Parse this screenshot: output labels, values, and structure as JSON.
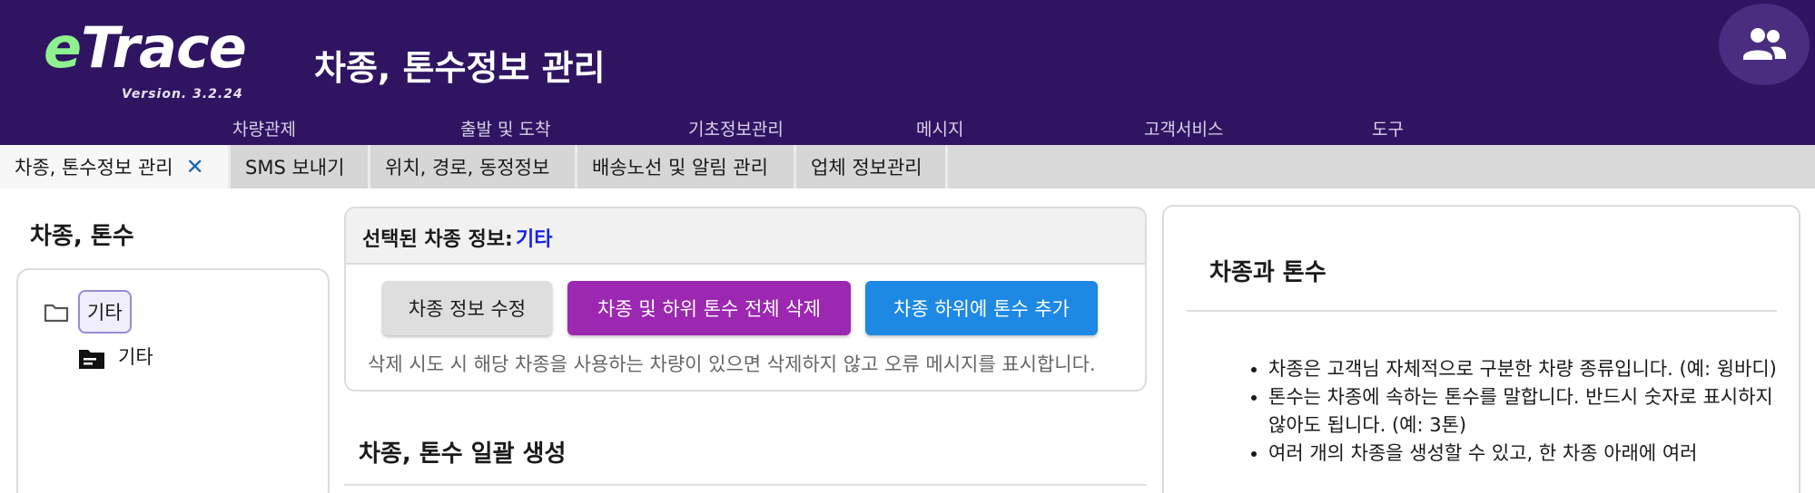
{
  "app": {
    "logo_e": "e",
    "logo_rest": "Trace",
    "version": "Version. 3.2.24",
    "page_title": "차종, 톤수정보 관리"
  },
  "menu": {
    "items": [
      "차량관제",
      "출발 및 도착",
      "기초정보관리",
      "메시지",
      "고객서비스",
      "도구"
    ]
  },
  "header_icon": "users-icon",
  "tabs": [
    {
      "label": "차종, 톤수정보 관리",
      "active": true,
      "closable": true
    },
    {
      "label": "SMS 보내기",
      "active": false
    },
    {
      "label": "위치, 경로, 동정정보",
      "active": false
    },
    {
      "label": "배송노선 및 알림 관리",
      "active": false
    },
    {
      "label": "업체 정보관리",
      "active": false
    }
  ],
  "left": {
    "title": "차종, 톤수",
    "tree": {
      "root_label": "기타",
      "root_icon": "folder-outline-icon",
      "child_label": "기타",
      "child_icon": "folder-filled-icon"
    }
  },
  "selected": {
    "label": "선택된 차종 정보: ",
    "value": "기타",
    "edit_button": "차종 정보 수정",
    "delete_button": "차종 및 하위 톤수 전체 삭제",
    "add_button": "차종 하위에 톤수 추가",
    "note": "삭제 시도 시 해당 차종을 사용하는 차량이 있으면 삭제하지 않고 오류 메시지를 표시합니다."
  },
  "bulk": {
    "title": "차종, 톤수 일괄 생성"
  },
  "info": {
    "title": "차종과 톤수",
    "bullets": [
      "차종은 고객님 자체적으로 구분한 차량 종류입니다. (예: 윙바디)",
      "톤수는 차종에 속하는 톤수를 말합니다. 반드시 숫자로 표시하지 않아도 됩니다. (예: 3톤)",
      "여러 개의 차종을 생성할 수 있고, 한 차종 아래에 여러"
    ]
  },
  "colors": {
    "header_bg": "#2f1561",
    "logo_accent": "#8ff08f",
    "delete_btn": "#9c27b0",
    "add_btn": "#1e88e5",
    "selected_value": "#1a22e0"
  }
}
